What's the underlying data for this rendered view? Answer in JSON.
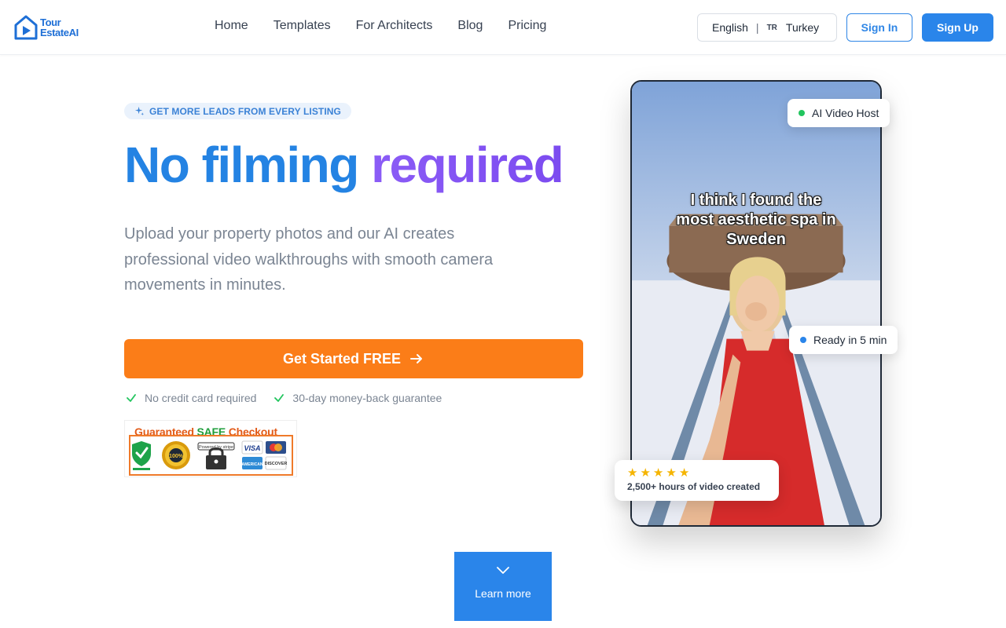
{
  "brand": {
    "line1": "Tour",
    "line2": "EstateAI"
  },
  "nav": {
    "items": [
      "Home",
      "Templates",
      "For Architects",
      "Blog",
      "Pricing"
    ]
  },
  "language": {
    "label": "English",
    "separator": "|",
    "country_code": "TR",
    "country": "Turkey"
  },
  "auth": {
    "sign_in": "Sign In",
    "sign_up": "Sign Up"
  },
  "hero": {
    "badge": "GET MORE LEADS FROM EVERY LISTING",
    "title_part1": "No filming",
    "title_part2": "required",
    "description": "Upload your property photos and our AI creates professional video walkthroughs with smooth camera movements in minutes.",
    "cta": "Get Started FREE",
    "checks": [
      "No credit card required",
      "30-day money-back guarantee"
    ]
  },
  "seal": {
    "heading_prefix": "Guaranteed ",
    "heading_safe": "SAFE",
    "heading_suffix": " Checkout"
  },
  "video": {
    "caption": "I think I found the\nmost aesthetic spa in\nSweden",
    "host_label": "AI Video Host",
    "ready_label": "Ready in 5 min",
    "rating_stars": 5,
    "rating_text": "2,500+ hours of video created"
  },
  "learn_more": {
    "label": "Learn more"
  },
  "colors": {
    "primary": "#2a85ea",
    "cta": "#fb7d18",
    "purple": "#8b5cf6",
    "green": "#22c55e"
  }
}
